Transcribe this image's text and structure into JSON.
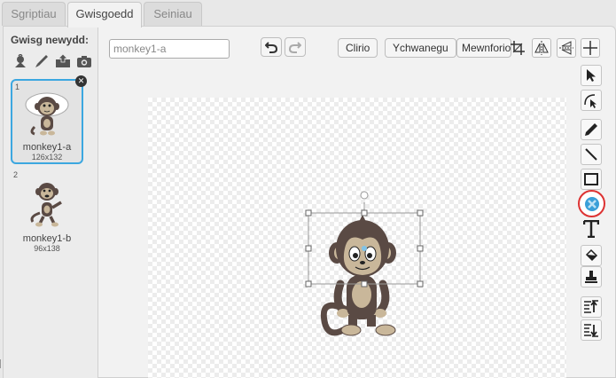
{
  "tabs": [
    {
      "label": "Sgriptiau"
    },
    {
      "label": "Gwisgoedd"
    },
    {
      "label": "Seiniau"
    }
  ],
  "sidebar": {
    "new_costume_label": "Gwisg newydd:",
    "new_icons": [
      "sprite-library-icon",
      "paint-brush-icon",
      "upload-icon",
      "camera-icon"
    ],
    "costumes": [
      {
        "index": "1",
        "name": "monkey1-a",
        "size": "126x132",
        "selected": true
      },
      {
        "index": "2",
        "name": "monkey1-b",
        "size": "96x138",
        "selected": false
      }
    ]
  },
  "editor": {
    "name_value": "monkey1-a",
    "undo_icon": "undo-icon",
    "redo_icon": "redo-icon",
    "clear_label": "Clirio",
    "add_label": "Ychwanegu",
    "import_label": "Mewnforio",
    "top_icons": [
      "crop-icon",
      "flip-horizontal-icon",
      "flip-vertical-icon",
      "crosshair-icon"
    ],
    "tools": [
      "select-icon",
      "reshape-icon",
      "pencil-icon",
      "line-icon",
      "rectangle-icon",
      "ellipse-icon",
      "text-icon",
      "fill-icon",
      "stamp-icon",
      "bring-forward-icon",
      "send-backward-icon"
    ],
    "highlighted_tool": "ellipse-icon"
  },
  "colors": {
    "selection_border": "#3ca7e0",
    "highlight": "#dd3333",
    "monkey_brown": "#5a4a44",
    "monkey_face": "#c9b79a"
  }
}
